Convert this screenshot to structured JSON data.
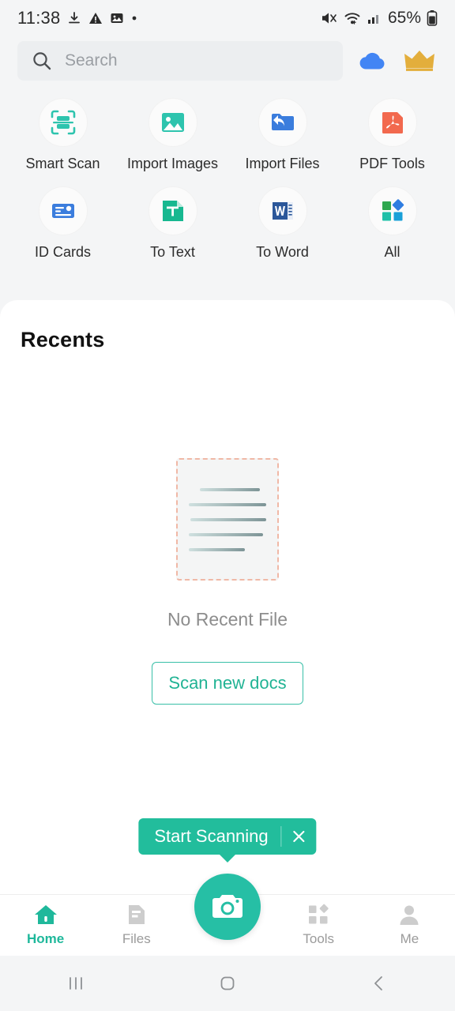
{
  "status_bar": {
    "time": "11:38",
    "battery_percent": "65%",
    "left_icons": [
      "download-icon",
      "warning-icon",
      "image-icon",
      "dot-icon"
    ],
    "right_icons": [
      "mute-icon",
      "wifi-icon",
      "signal-icon",
      "battery-icon"
    ]
  },
  "search": {
    "placeholder": "Search",
    "icon": "search-icon",
    "cloud_icon": "cloud-icon",
    "crown_icon": "crown-icon"
  },
  "quick_actions": [
    {
      "label": "Smart Scan",
      "icon": "smart-scan-icon"
    },
    {
      "label": "Import Images",
      "icon": "import-images-icon"
    },
    {
      "label": "Import Files",
      "icon": "import-files-icon"
    },
    {
      "label": "PDF Tools",
      "icon": "pdf-tools-icon"
    },
    {
      "label": "ID Cards",
      "icon": "id-cards-icon"
    },
    {
      "label": "To Text",
      "icon": "to-text-icon"
    },
    {
      "label": "To Word",
      "icon": "to-word-icon"
    },
    {
      "label": "All",
      "icon": "all-tools-icon"
    }
  ],
  "recents": {
    "title": "Recents",
    "empty_text": "No Recent File",
    "scan_button": "Scan new docs",
    "illustration": "empty-document-icon"
  },
  "tooltip": {
    "label": "Start Scanning",
    "close_icon": "close-icon"
  },
  "bottom_nav": {
    "items": [
      {
        "label": "Home",
        "icon": "home-icon",
        "active": true
      },
      {
        "label": "Files",
        "icon": "files-icon",
        "active": false
      },
      {
        "label": "Tools",
        "icon": "tools-icon",
        "active": false
      },
      {
        "label": "Me",
        "icon": "person-icon",
        "active": false
      }
    ],
    "fab_icon": "camera-icon"
  },
  "system_nav": {
    "recents": "recents-icon",
    "home": "home-square-icon",
    "back": "back-chevron-icon"
  },
  "colors": {
    "accent_teal": "#26BFA5",
    "tooltip_teal": "#22BD9C",
    "cloud_blue": "#4285F4",
    "crown_gold": "#E3AE3C",
    "pdf_red": "#F2694E"
  }
}
